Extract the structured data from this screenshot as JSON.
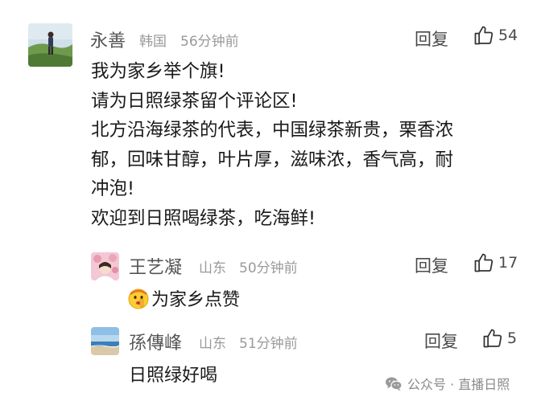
{
  "comments": {
    "main": {
      "username": "永善",
      "location": "韩国",
      "time": "56分钟前",
      "reply_label": "回复",
      "likes": "54",
      "lines": [
        "我为家乡举个旗!",
        "请为日照绿茶留个评论区!",
        "北方沿海绿茶的代表，中国绿茶新贵，栗香浓",
        "郁，回味甘醇，叶片厚，滋味浓，香气高，耐",
        "冲泡!",
        "欢迎到日照喝绿茶，吃海鲜!"
      ]
    },
    "replies": [
      {
        "username": "王艺凝",
        "location": "山东",
        "time": "50分钟前",
        "reply_label": "回复",
        "likes": "17",
        "text": "为家乡点赞"
      },
      {
        "username": "孫傳峰",
        "location": "山东",
        "time": "51分钟前",
        "reply_label": "回复",
        "likes": "5",
        "text": "日照绿好喝"
      }
    ]
  },
  "watermark": {
    "text": "公众号 · 直播日照",
    "icon": "wechat-icon"
  },
  "colors": {
    "text_primary": "#1a1a1a",
    "username": "#555555",
    "meta": "#9a9a9a"
  }
}
